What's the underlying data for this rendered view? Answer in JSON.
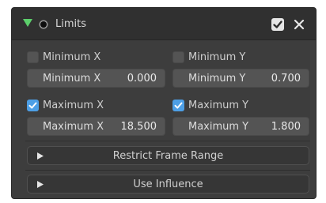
{
  "header": {
    "title": "Limits",
    "expand_icon": "triangle-down-icon",
    "expand_color": "#5ccf6b",
    "enabled": true,
    "close_icon": "close-icon"
  },
  "limits": {
    "min_x": {
      "checkbox_label": "Minimum X",
      "enabled": false,
      "field_label": "Minimum X",
      "value": "0.000"
    },
    "min_y": {
      "checkbox_label": "Minimum Y",
      "enabled": false,
      "field_label": "Minimum Y",
      "value": "0.700"
    },
    "max_x": {
      "checkbox_label": "Maximum X",
      "enabled": true,
      "field_label": "Maximum X",
      "value": "18.500"
    },
    "max_y": {
      "checkbox_label": "Maximum Y",
      "enabled": true,
      "field_label": "Maximum Y",
      "value": "1.800"
    }
  },
  "subpanels": {
    "restrict": {
      "label": "Restrict Frame Range",
      "icon": "triangle-right-icon"
    },
    "influence": {
      "label": "Use Influence",
      "icon": "triangle-right-icon"
    }
  },
  "colors": {
    "checkbox_on": "#4d9fe6",
    "panel_bg": "#3d3d3d",
    "header_bg": "#303030"
  }
}
